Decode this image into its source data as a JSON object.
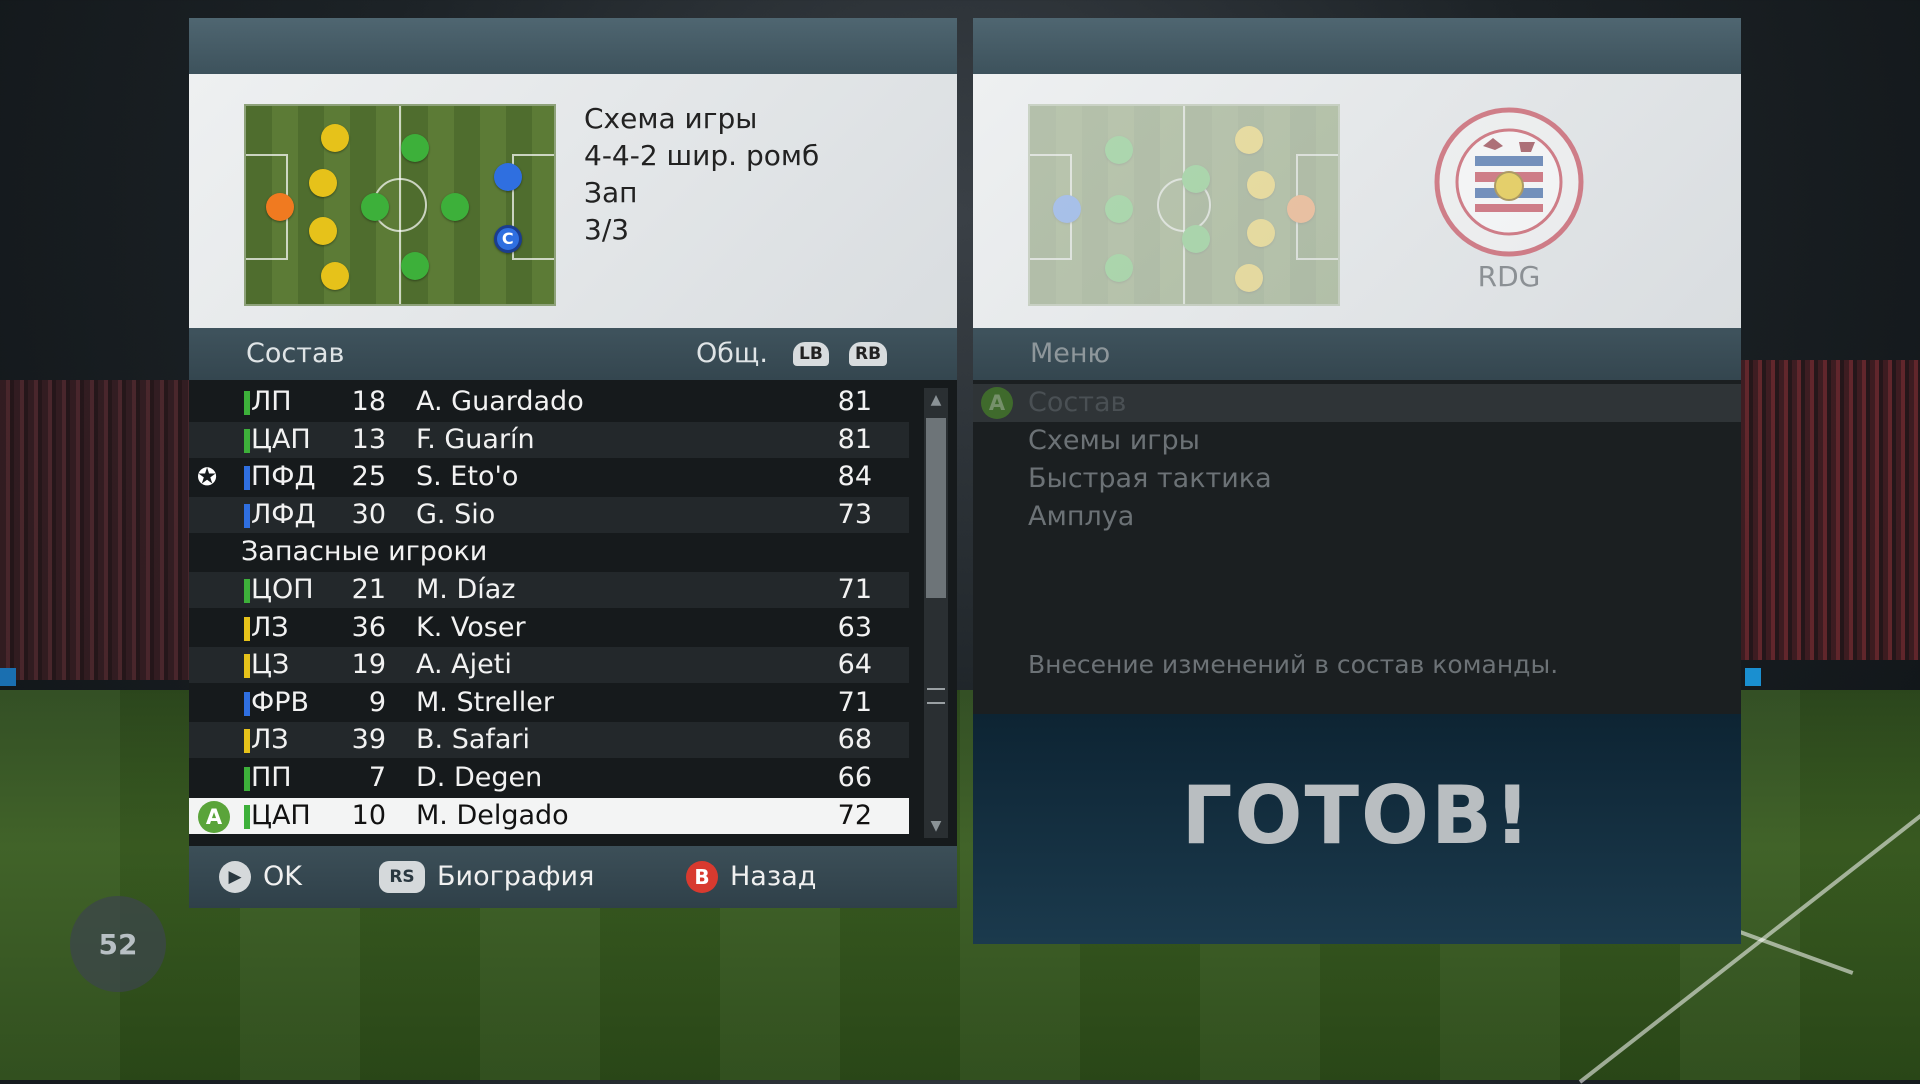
{
  "left_panel": {
    "formation": {
      "label": "Схема игры",
      "name": "4-4-2 шир. ромб",
      "subs_label": "Зап",
      "subs_count": "3/3"
    },
    "squad_header": {
      "title": "Состав",
      "overall_label": "Общ.",
      "lb": "LB",
      "rb": "RB"
    },
    "rows": [
      {
        "bar": "#3db03a",
        "pos": "ЛП",
        "num": "18",
        "name": "A. Guardado",
        "rating": "81"
      },
      {
        "bar": "#3db03a",
        "pos": "ЦАП",
        "num": "13",
        "name": "F. Guarín",
        "rating": "81"
      },
      {
        "bar": "#2f6fe0",
        "pos": "ПФД",
        "num": "25",
        "name": "S. Eto'o",
        "rating": "84",
        "icon": "star-player-icon"
      },
      {
        "bar": "#2f6fe0",
        "pos": "ЛФД",
        "num": "30",
        "name": "G. Sio",
        "rating": "73"
      }
    ],
    "subs_section": "Запасные игроки",
    "subs": [
      {
        "bar": "#3db03a",
        "pos": "ЦОП",
        "num": "21",
        "name": "M. Díaz",
        "rating": "71"
      },
      {
        "bar": "#e6c21a",
        "pos": "ЛЗ",
        "num": "36",
        "name": "K. Voser",
        "rating": "63"
      },
      {
        "bar": "#e6c21a",
        "pos": "ЦЗ",
        "num": "19",
        "name": "A. Ajeti",
        "rating": "64"
      },
      {
        "bar": "#2f6fe0",
        "pos": "ФРВ",
        "num": "9",
        "name": "M. Streller",
        "rating": "71"
      },
      {
        "bar": "#e6c21a",
        "pos": "ЛЗ",
        "num": "39",
        "name": "B. Safari",
        "rating": "68"
      },
      {
        "bar": "#3db03a",
        "pos": "ПП",
        "num": "7",
        "name": "D. Degen",
        "rating": "66"
      },
      {
        "bar": "#3db03a",
        "pos": "ЦАП",
        "num": "10",
        "name": "M. Delgado",
        "rating": "72",
        "selected": true
      }
    ],
    "selected_badge": "A",
    "captain_badge": "C",
    "footer": {
      "ok": "OK",
      "bio_icon": "RS",
      "bio": "Биография",
      "back_icon": "B",
      "back": "Назад"
    }
  },
  "right_panel": {
    "club_code": "RDG",
    "menu_title": "Меню",
    "menu_badge": "A",
    "menu_items": [
      "Состав",
      "Схемы игры",
      "Быстрая тактика",
      "Амплуа"
    ],
    "menu_description": "Внесение изменений в состав команды.",
    "ready": "ГОТОВ!"
  },
  "page_counter": "52",
  "colors": {
    "defender": "#e6c21a",
    "midfielder": "#3db03a",
    "forward": "#2f6fe0",
    "goalkeeper": "#f07a20"
  }
}
